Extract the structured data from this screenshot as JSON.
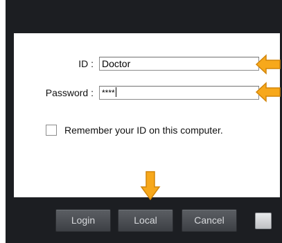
{
  "form": {
    "id_label": "ID :",
    "id_value": "Doctor",
    "password_label": "Password :",
    "password_value": "****",
    "remember_label": "Remember your ID on this computer.",
    "remember_checked": false
  },
  "buttons": {
    "login": "Login",
    "local": "Local",
    "cancel": "Cancel"
  },
  "colors": {
    "dialog_bg": "#1c1e22",
    "panel_bg": "#ffffff",
    "annotation_arrow": "#f7a81b"
  },
  "icons": {
    "annotation": "orange-arrow-icon"
  }
}
